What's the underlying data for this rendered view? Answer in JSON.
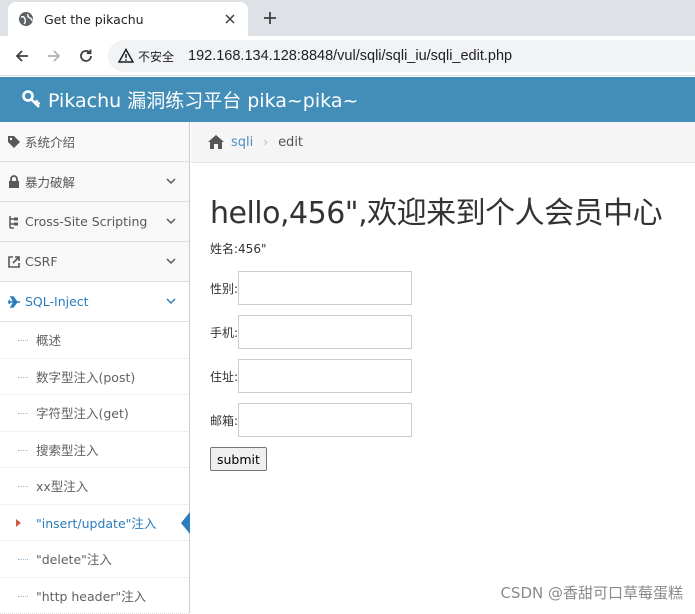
{
  "browser": {
    "tab_title": "Get the pikachu",
    "security_label": "不安全",
    "url": "192.168.134.128:8848/vul/sqli/sqli_iu/sqli_edit.php"
  },
  "header": {
    "title": "Pikachu 漏洞练习平台 pika~pika~"
  },
  "sidebar": {
    "items": [
      {
        "label": "系统介绍",
        "icon": "tag-icon"
      },
      {
        "label": "暴力破解",
        "icon": "lock-icon"
      },
      {
        "label": "Cross-Site Scripting",
        "icon": "sitemap-icon"
      },
      {
        "label": "CSRF",
        "icon": "share-icon"
      },
      {
        "label": "SQL-Inject",
        "icon": "plane-icon"
      }
    ],
    "sub_items": [
      {
        "label": "概述"
      },
      {
        "label": "数字型注入(post)"
      },
      {
        "label": "字符型注入(get)"
      },
      {
        "label": "搜索型注入"
      },
      {
        "label": "xx型注入"
      },
      {
        "label": "\"insert/update\"注入"
      },
      {
        "label": "\"delete\"注入"
      },
      {
        "label": "\"http header\"注入"
      }
    ]
  },
  "breadcrumbs": {
    "section": "sqli",
    "current": "edit"
  },
  "main": {
    "heading": "hello,456\",欢迎来到个人会员中心",
    "name_line": "姓名:456\"",
    "fields": [
      {
        "label": "性别:"
      },
      {
        "label": "手机:"
      },
      {
        "label": "住址:"
      },
      {
        "label": "邮箱:"
      }
    ],
    "submit_label": "submit"
  },
  "watermark": "CSDN @香甜可口草莓蛋糕",
  "colors": {
    "header_bg": "#438eb9",
    "active_blue": "#2b7dbc"
  }
}
